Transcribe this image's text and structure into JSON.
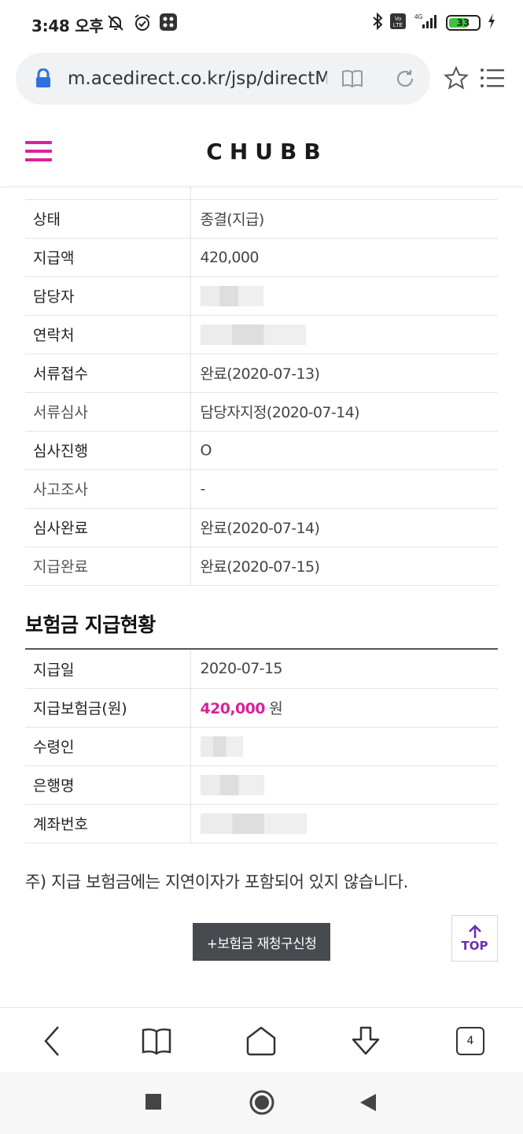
{
  "status": {
    "time": "3:48 오후",
    "battery": "33"
  },
  "browser": {
    "url": "m.acedirect.co.kr/jsp/directM",
    "tabs_count": "4"
  },
  "header": {
    "logo": "CHUBB"
  },
  "claim_status": {
    "rows": [
      {
        "label": "상태",
        "value": "종결(지급)"
      },
      {
        "label": "지급액",
        "value": "420,000"
      },
      {
        "label": "담당자",
        "value": ""
      },
      {
        "label": "연락처",
        "value": ""
      },
      {
        "label": "서류접수",
        "value": "완료(2020-07-13)"
      },
      {
        "label": "서류심사",
        "value": "담당자지정(2020-07-14)"
      },
      {
        "label": "심사진행",
        "value": "O"
      },
      {
        "label": "사고조사",
        "value": "-"
      },
      {
        "label": "심사완료",
        "value": "완료(2020-07-14)"
      },
      {
        "label": "지급완료",
        "value": "완료(2020-07-15)"
      }
    ]
  },
  "payment": {
    "title": "보험금 지급현황",
    "rows": [
      {
        "label": "지급일",
        "value": "2020-07-15"
      },
      {
        "label": "지급보험금(원)",
        "amount": "420,000",
        "unit": "원"
      },
      {
        "label": "수령인",
        "value": ""
      },
      {
        "label": "은행명",
        "value": ""
      },
      {
        "label": "계좌번호",
        "value": ""
      }
    ]
  },
  "note": "주) 지급 보험금에는 지연이자가 포함되어 있지 않습니다.",
  "buttons": {
    "reclaim": "+보험금 재청구신청",
    "top": "TOP"
  },
  "colors": {
    "accent": "#d6259a",
    "top_purple": "#6b2fae",
    "button_dark": "#474a4f"
  }
}
